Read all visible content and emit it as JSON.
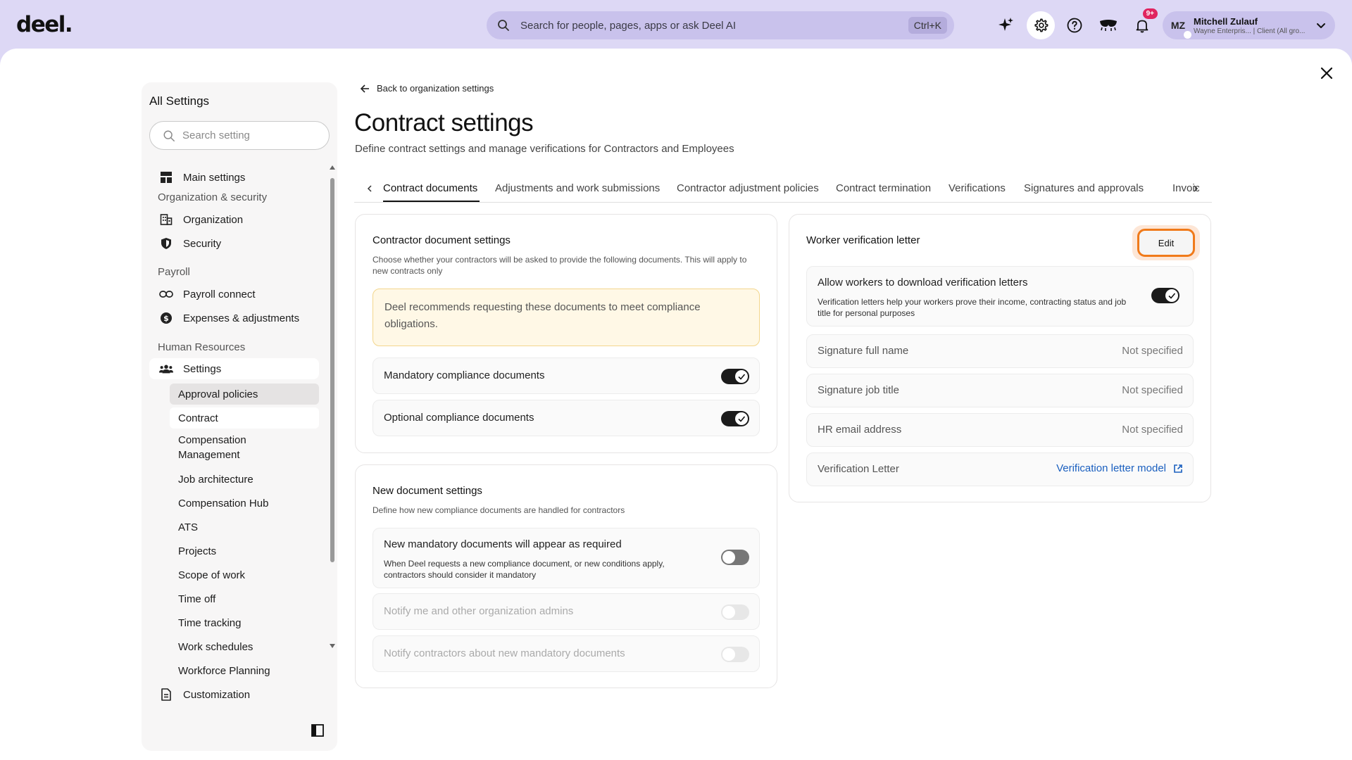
{
  "topbar": {
    "logo": "deel.",
    "search_placeholder": "Search for people, pages, apps or ask Deel AI",
    "search_shortcut": "Ctrl+K",
    "notification_badge": "9+",
    "user": {
      "initials": "MZ",
      "name": "Mitchell Zulauf",
      "subtitle": "Wayne Enterpris... | Client (All gro..."
    }
  },
  "sidebar": {
    "title": "All Settings",
    "search_placeholder": "Search setting",
    "main_settings": "Main settings",
    "section_org": "Organization & security",
    "organization": "Organization",
    "security": "Security",
    "section_payroll": "Payroll",
    "payroll_connect": "Payroll connect",
    "expenses": "Expenses & adjustments",
    "section_hr": "Human Resources",
    "settings": "Settings",
    "sub_items": [
      "Approval policies",
      "Contract",
      "Compensation Management",
      "Job architecture",
      "Compensation Hub",
      "ATS",
      "Projects",
      "Scope of work",
      "Time off",
      "Time tracking",
      "Work schedules",
      "Workforce Planning"
    ],
    "customization": "Customization"
  },
  "page": {
    "back_link": "Back to organization settings",
    "title": "Contract settings",
    "subtitle": "Define contract settings and manage verifications for Contractors and Employees",
    "tabs": [
      "Contract documents",
      "Adjustments and work submissions",
      "Contractor adjustment policies",
      "Contract termination",
      "Verifications",
      "Signatures and approvals",
      "Invoices"
    ],
    "active_tab": "Contract documents"
  },
  "contractor_docs": {
    "title": "Contractor document settings",
    "description": "Choose whether your contractors will be asked to provide the following documents. This will apply to new contracts only",
    "note": "Deel recommends requesting these documents to meet compliance obligations.",
    "rows": [
      {
        "label": "Mandatory compliance documents",
        "enabled": true
      },
      {
        "label": "Optional compliance documents",
        "enabled": true
      }
    ]
  },
  "new_docs": {
    "title": "New document settings",
    "description": "Define how new compliance documents are handled for contractors",
    "main_row": {
      "label": "New mandatory documents will appear as required",
      "description": "When Deel requests a new compliance document, or new conditions apply, contractors should consider it mandatory",
      "enabled": false
    },
    "notify_admins": "Notify me and other organization admins",
    "notify_contractors": "Notify contractors about new mandatory documents"
  },
  "verification": {
    "title": "Worker verification letter",
    "edit_label": "Edit",
    "allow_row": {
      "label": "Allow workers to download verification letters",
      "description": "Verification letters help your workers prove their income, contracting status and job title for personal purposes",
      "enabled": true
    },
    "fields": [
      {
        "label": "Signature full name",
        "value": "Not specified"
      },
      {
        "label": "Signature job title",
        "value": "Not specified"
      },
      {
        "label": "HR email address",
        "value": "Not specified"
      }
    ],
    "letter_label": "Verification Letter",
    "letter_link": "Verification letter model"
  }
}
